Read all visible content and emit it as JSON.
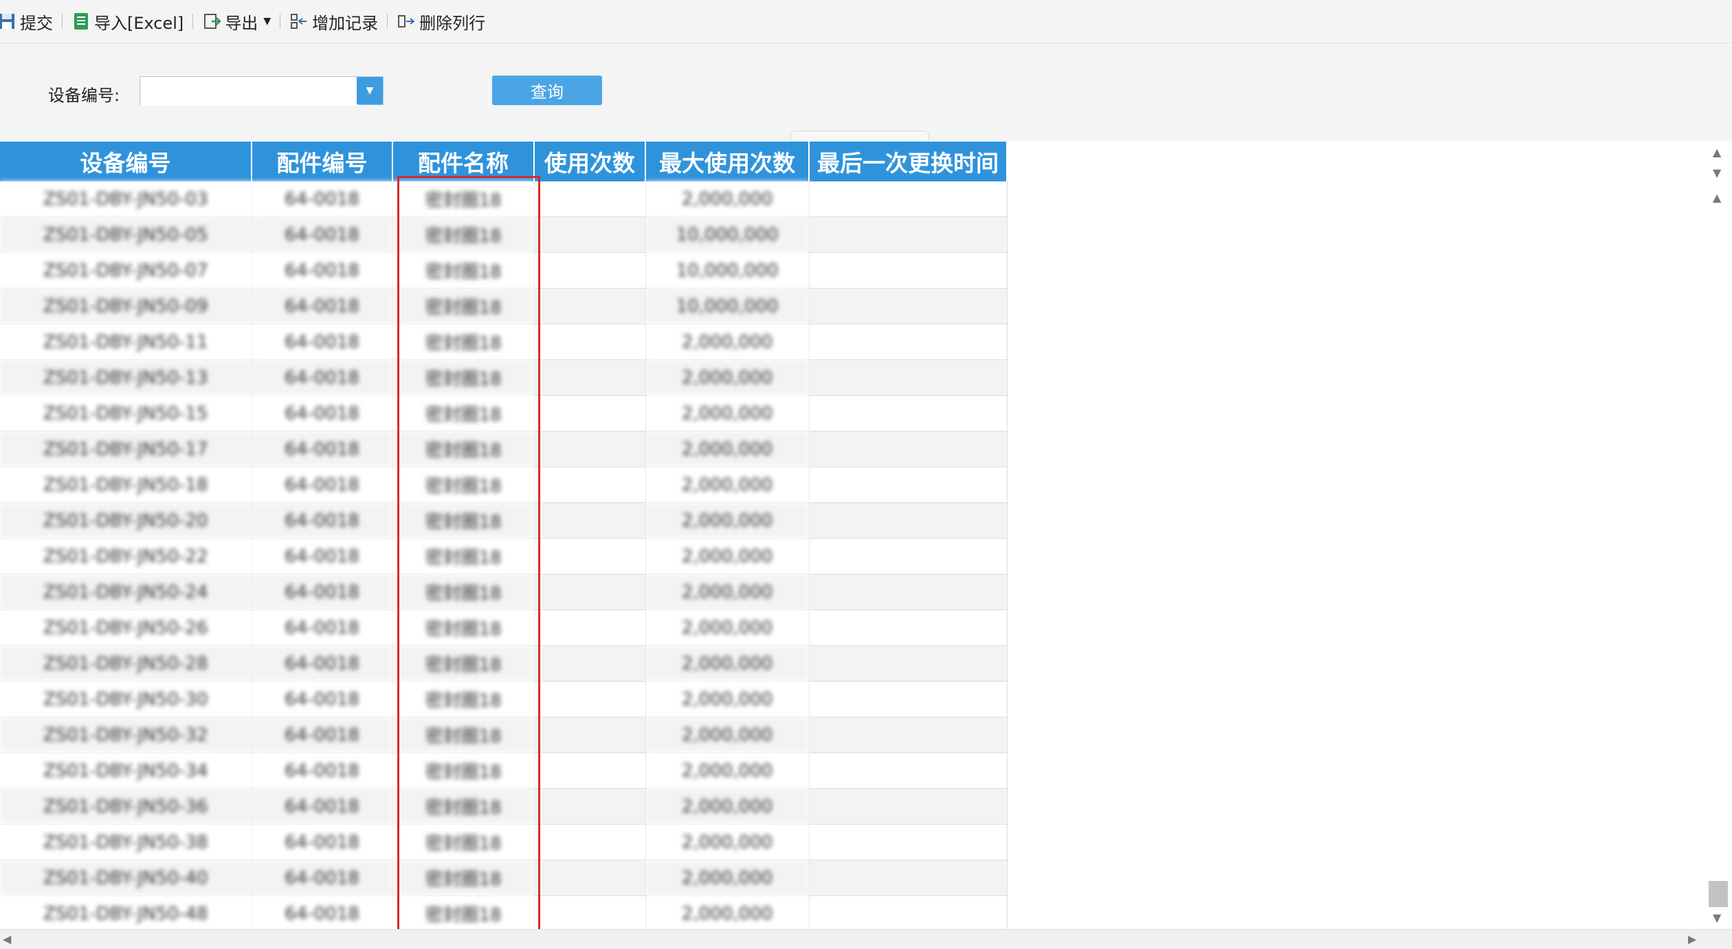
{
  "toolbar": {
    "items": [
      {
        "label": "提交",
        "icon": "save-icon"
      },
      {
        "label": "导入[Excel]",
        "icon": "excel-import-icon"
      },
      {
        "label": "导出",
        "icon": "export-icon"
      },
      {
        "label": "增加记录",
        "icon": "add-record-icon"
      },
      {
        "label": "删除列行",
        "icon": "delete-row-icon"
      }
    ]
  },
  "filter": {
    "label": "设备编号:",
    "value": "",
    "query_label": "查询"
  },
  "colors": {
    "header_bg": "#2f93dc",
    "button_bg": "#4aa5e5",
    "highlight": "#d62a2a"
  },
  "grid": {
    "columns": [
      "设备编号",
      "配件编号",
      "配件名称",
      "使用次数",
      "最大使用次数",
      "最后一次更换时间"
    ],
    "rows": [
      [
        "ZS01-DBY-JN50-03",
        "64-0018",
        "密封圈18",
        "",
        "2,000,000",
        ""
      ],
      [
        "ZS01-DBY-JN50-05",
        "64-0018",
        "密封圈18",
        "",
        "10,000,000",
        ""
      ],
      [
        "ZS01-DBY-JN50-07",
        "64-0018",
        "密封圈18",
        "",
        "10,000,000",
        ""
      ],
      [
        "ZS01-DBY-JN50-09",
        "64-0018",
        "密封圈18",
        "",
        "10,000,000",
        ""
      ],
      [
        "ZS01-DBY-JN50-11",
        "64-0018",
        "密封圈18",
        "",
        "2,000,000",
        ""
      ],
      [
        "ZS01-DBY-JN50-13",
        "64-0018",
        "密封圈18",
        "",
        "2,000,000",
        ""
      ],
      [
        "ZS01-DBY-JN50-15",
        "64-0018",
        "密封圈18",
        "",
        "2,000,000",
        ""
      ],
      [
        "ZS01-DBY-JN50-17",
        "64-0018",
        "密封圈18",
        "",
        "2,000,000",
        ""
      ],
      [
        "ZS01-DBY-JN50-18",
        "64-0018",
        "密封圈18",
        "",
        "2,000,000",
        ""
      ],
      [
        "ZS01-DBY-JN50-20",
        "64-0018",
        "密封圈18",
        "",
        "2,000,000",
        ""
      ],
      [
        "ZS01-DBY-JN50-22",
        "64-0018",
        "密封圈18",
        "",
        "2,000,000",
        ""
      ],
      [
        "ZS01-DBY-JN50-24",
        "64-0018",
        "密封圈18",
        "",
        "2,000,000",
        ""
      ],
      [
        "ZS01-DBY-JN50-26",
        "64-0018",
        "密封圈18",
        "",
        "2,000,000",
        ""
      ],
      [
        "ZS01-DBY-JN50-28",
        "64-0018",
        "密封圈18",
        "",
        "2,000,000",
        ""
      ],
      [
        "ZS01-DBY-JN50-30",
        "64-0018",
        "密封圈18",
        "",
        "2,000,000",
        ""
      ],
      [
        "ZS01-DBY-JN50-32",
        "64-0018",
        "密封圈18",
        "",
        "2,000,000",
        ""
      ],
      [
        "ZS01-DBY-JN50-34",
        "64-0018",
        "密封圈18",
        "",
        "2,000,000",
        ""
      ],
      [
        "ZS01-DBY-JN50-36",
        "64-0018",
        "密封圈18",
        "",
        "2,000,000",
        ""
      ],
      [
        "ZS01-DBY-JN50-38",
        "64-0018",
        "密封圈18",
        "",
        "2,000,000",
        ""
      ],
      [
        "ZS01-DBY-JN50-40",
        "64-0018",
        "密封圈18",
        "",
        "2,000,000",
        ""
      ],
      [
        "ZS01-DBY-JN50-48",
        "64-0018",
        "密封圈18",
        "",
        "2,000,000",
        ""
      ]
    ]
  }
}
